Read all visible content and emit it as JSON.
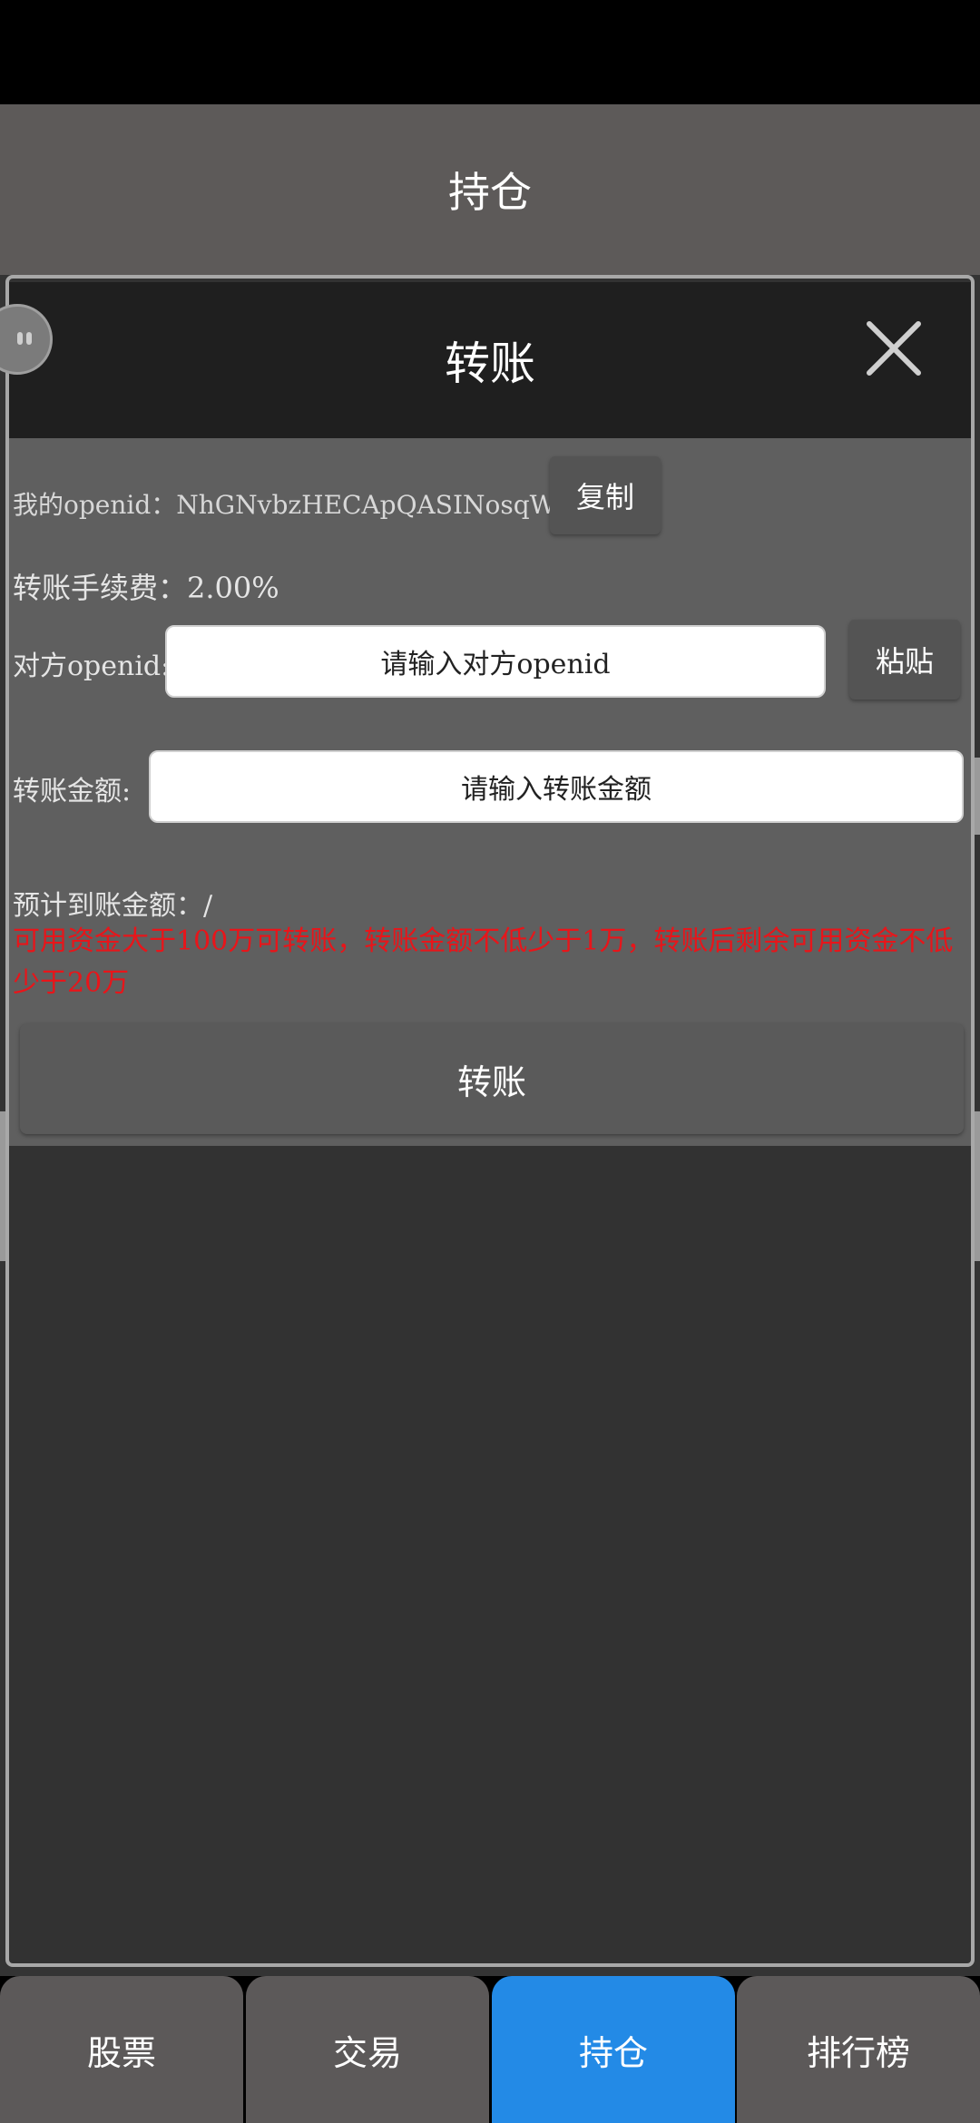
{
  "header": {
    "title": "持仓"
  },
  "modal": {
    "title": "转账",
    "openid_label": "我的openid：NhGNvbzHECApQASINosqWA==",
    "copy_label": "复制",
    "fee_label": "转账手续费：2.00%",
    "peer_label": "对方openid:",
    "peer_placeholder": "请输入对方openid",
    "paste_label": "粘贴",
    "amount_label": "转账金额:",
    "amount_placeholder": "请输入转账金额",
    "expected_label": "预计到账金额：/",
    "warning": "可用资金大于100万可转账，转账金额不低少于1万，转账后剩余可用资金不低少于20万",
    "submit_label": "转账"
  },
  "nav": {
    "tabs": [
      {
        "label": "股票"
      },
      {
        "label": "交易"
      },
      {
        "label": "持仓"
      },
      {
        "label": "排行榜"
      }
    ],
    "active_index": 2
  },
  "colors": {
    "accent": "#238ae6",
    "warning": "#e8151a"
  },
  "icons": {
    "close": "close-icon",
    "bubble": "floating-bubble-icon"
  }
}
